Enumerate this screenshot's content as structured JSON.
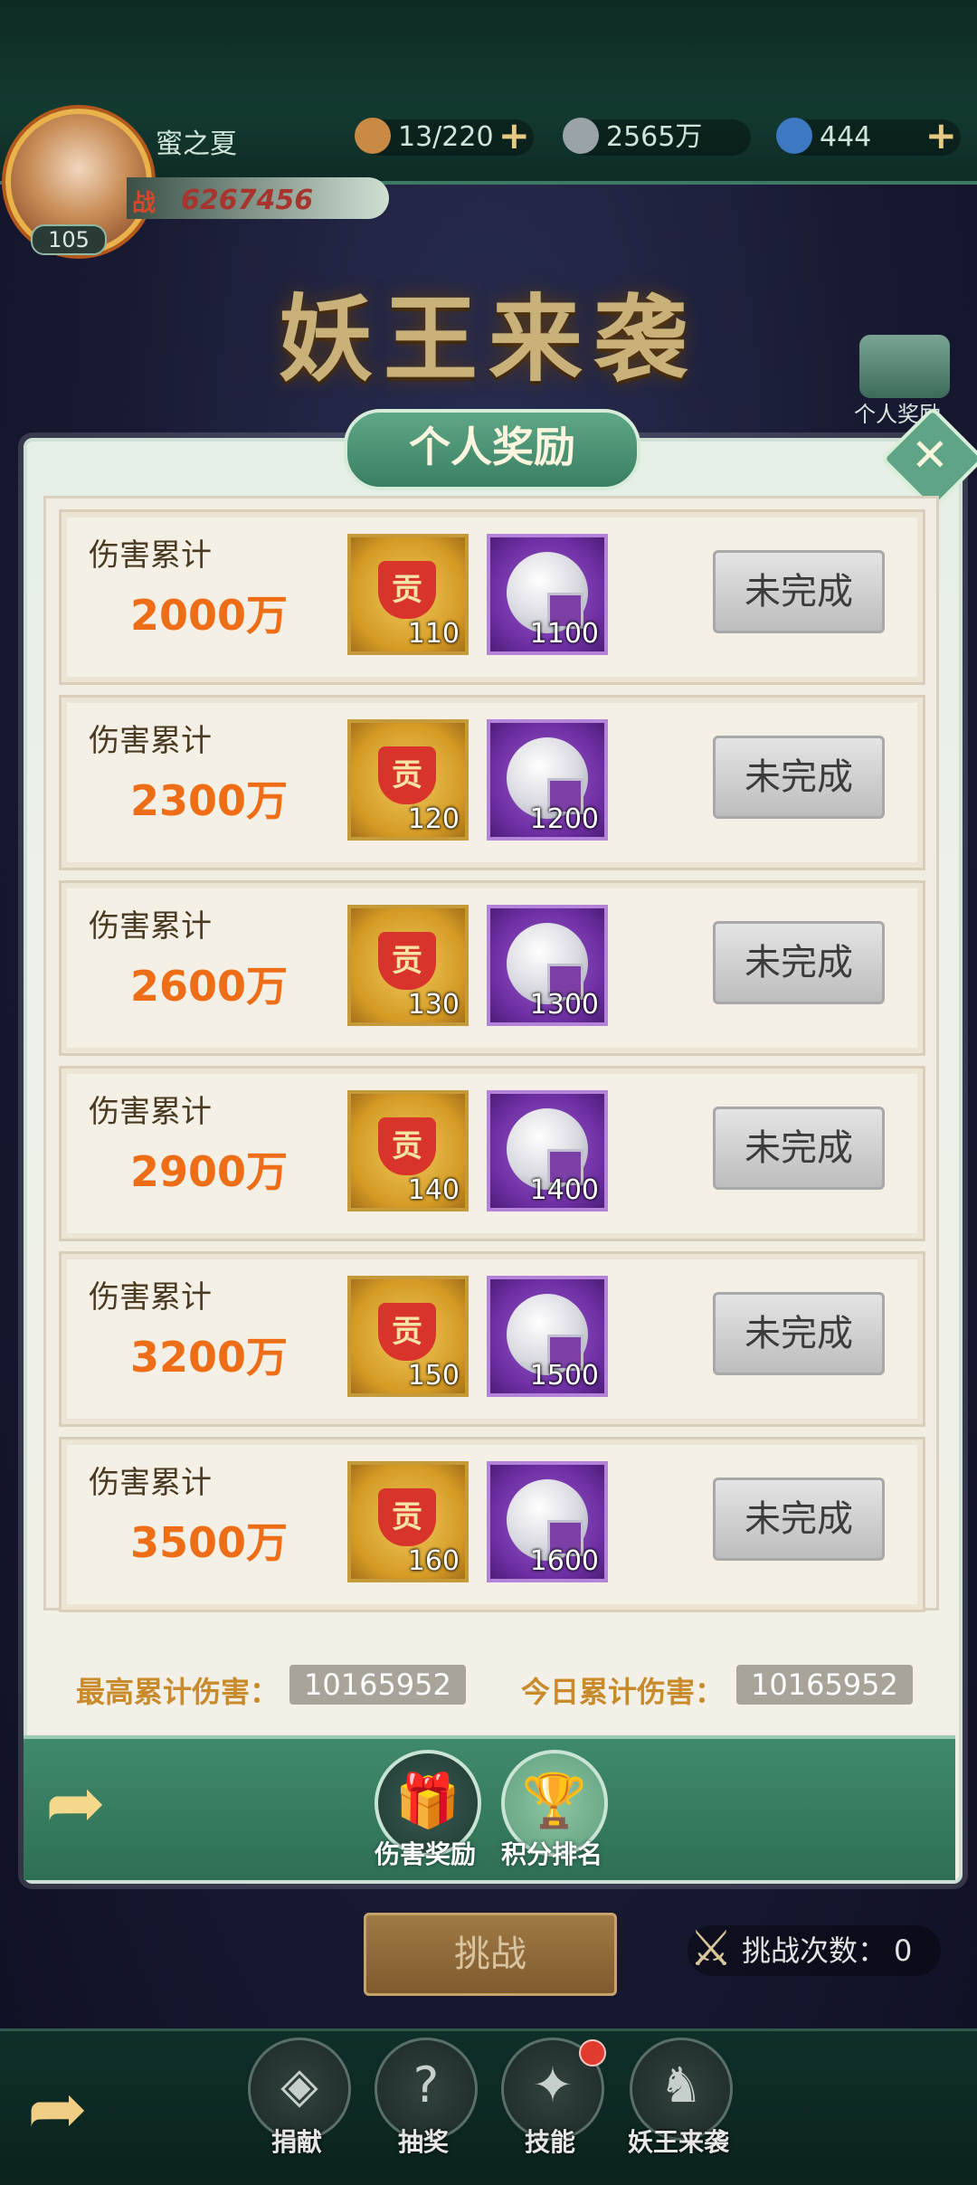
{
  "player": {
    "name": "蜜之夏",
    "level": "105",
    "power_tag": "战",
    "power": "6267456"
  },
  "resources": [
    {
      "icon": "bun-icon",
      "value": "13/220",
      "has_plus": true
    },
    {
      "icon": "coin-icon",
      "value": "2565万",
      "has_plus": false
    },
    {
      "icon": "energy-icon",
      "value": "444",
      "has_plus": true
    }
  ],
  "event_title": "妖王来袭",
  "side_button": {
    "label": "个人奖励"
  },
  "panel": {
    "title": "个人奖励",
    "close_label": "✕"
  },
  "rewards": [
    {
      "label": "伤害累计",
      "amount": "2000万",
      "item1_count": "110",
      "item2_count": "1100",
      "status": "未完成"
    },
    {
      "label": "伤害累计",
      "amount": "2300万",
      "item1_count": "120",
      "item2_count": "1200",
      "status": "未完成"
    },
    {
      "label": "伤害累计",
      "amount": "2600万",
      "item1_count": "130",
      "item2_count": "1300",
      "status": "未完成"
    },
    {
      "label": "伤害累计",
      "amount": "2900万",
      "item1_count": "140",
      "item2_count": "1400",
      "status": "未完成"
    },
    {
      "label": "伤害累计",
      "amount": "3200万",
      "item1_count": "150",
      "item2_count": "1500",
      "status": "未完成"
    },
    {
      "label": "伤害累计",
      "amount": "3500万",
      "item1_count": "160",
      "item2_count": "1600",
      "status": "未完成"
    }
  ],
  "gold_badge_text": "贡",
  "stats": {
    "max_label": "最高累计伤害：",
    "max_value": "10165952",
    "today_label": "今日累计伤害：",
    "today_value": "10165952"
  },
  "tabs": [
    {
      "label": "伤害奖励",
      "icon": "gift-icon"
    },
    {
      "label": "积分排名",
      "icon": "podium-icon"
    }
  ],
  "challenge": {
    "button_label": "挑战",
    "attempts_label": "挑战次数：",
    "attempts_value": "0"
  },
  "bottom_nav": [
    {
      "label": "捐献",
      "icon": "donate-icon"
    },
    {
      "label": "抽奖",
      "icon": "lottery-icon"
    },
    {
      "label": "技能",
      "icon": "skill-icon"
    },
    {
      "label": "妖王来袭",
      "icon": "demon-king-icon"
    }
  ],
  "colors": {
    "amount": "#ee6d17",
    "stat_label": "#c98a2b",
    "panel_green": "#3f8a6b"
  }
}
